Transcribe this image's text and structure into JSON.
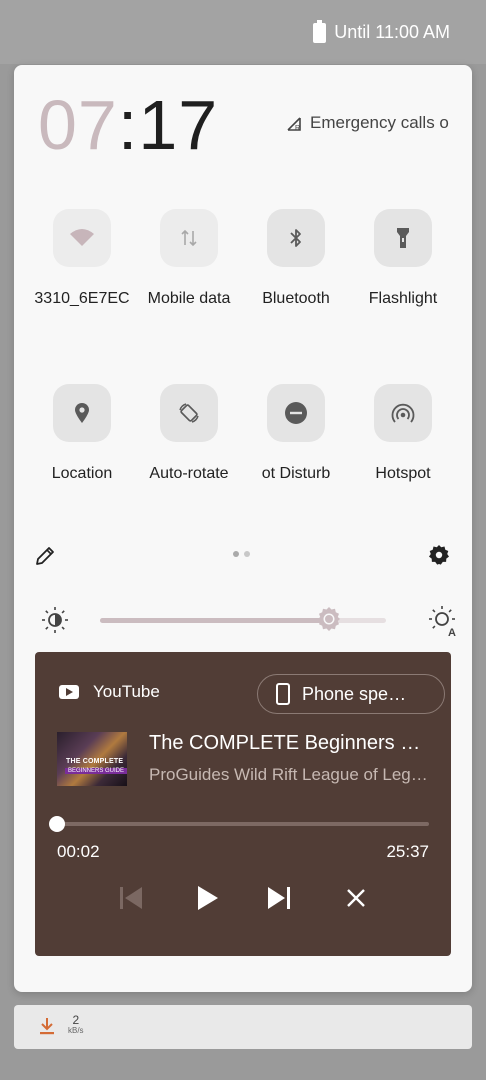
{
  "status_bar": {
    "battery_text": "Until 11:00 AM"
  },
  "clock": {
    "hours": "07",
    "separator": ":",
    "minutes": "17"
  },
  "emergency_text": "Emergency calls o",
  "tiles": [
    {
      "label": "3310_6E7EC",
      "icon": "wifi-icon",
      "active": false
    },
    {
      "label": "Mobile data",
      "icon": "mobile-data-icon",
      "active": false
    },
    {
      "label": "Bluetooth",
      "icon": "bluetooth-icon",
      "active": false
    },
    {
      "label": "Flashlight",
      "icon": "flashlight-icon",
      "active": false
    },
    {
      "label": "Location",
      "icon": "location-icon",
      "active": false
    },
    {
      "label": "Auto-rotate",
      "icon": "auto-rotate-icon",
      "active": false
    },
    {
      "label": "ot Disturb",
      "icon": "do-not-disturb-icon",
      "active": false
    },
    {
      "label": "Hotspot",
      "icon": "hotspot-icon",
      "active": false
    }
  ],
  "pager": {
    "pages": 2,
    "current": 1
  },
  "brightness": {
    "level": 0.8
  },
  "media": {
    "app_name": "YouTube",
    "output_device": "Phone spe…",
    "thumbnail_text_1": "THE COMPLETE",
    "thumbnail_text_2": "BEGINNERS GUIDE",
    "title": "The COMPLETE Beginners Guide to Wild Rift",
    "artist": "ProGuides Wild Rift League of Legends",
    "current_time": "00:02",
    "total_time": "25:37",
    "progress": 0.001,
    "colors": {
      "background": "#513d36",
      "secondary_text": "#c6b8b2"
    }
  },
  "bottom_bar": {
    "speed_value": "2",
    "speed_unit": "kB/s"
  },
  "colors": {
    "accent": "#cbbcc0",
    "panel": "#f8f8f8"
  }
}
